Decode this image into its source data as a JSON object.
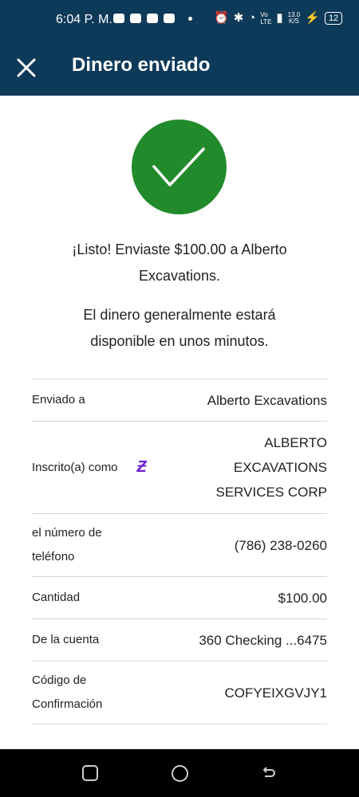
{
  "status_bar": {
    "time": "6:04 P. M.",
    "network_top": "13.0",
    "network_bottom": "K/S",
    "battery": "12"
  },
  "header": {
    "title": "Dinero enviado",
    "close_icon": "close-icon"
  },
  "colors": {
    "header_bg": "#0e3a5a",
    "success_green": "#218a2b",
    "zelle_purple": "#6b1fd1"
  },
  "main": {
    "message_line1": "¡Listo! Enviaste $100.00 a Alberto",
    "message_line2": "Excavations.",
    "note_line1": "El dinero generalmente estará",
    "note_line2": "disponible en unos minutos."
  },
  "details": {
    "sent_to": {
      "label": "Enviado a",
      "value": "Alberto Excavations"
    },
    "enrolled_as": {
      "label": "Inscrito(a) como",
      "value_line1": "ALBERTO",
      "value_line2": "EXCAVATIONS",
      "value_line3": "SERVICES CORP"
    },
    "phone": {
      "label_line1": "el número de",
      "label_line2": "teléfono",
      "value": "(786) 238-0260"
    },
    "amount": {
      "label": "Cantidad",
      "value": "$100.00"
    },
    "from_account": {
      "label": "De la cuenta",
      "value": "360 Checking ...6475"
    },
    "confirmation": {
      "label_line1": "Código de",
      "label_line2": "Confirmación",
      "value": "COFYEIXGVJY1"
    }
  }
}
